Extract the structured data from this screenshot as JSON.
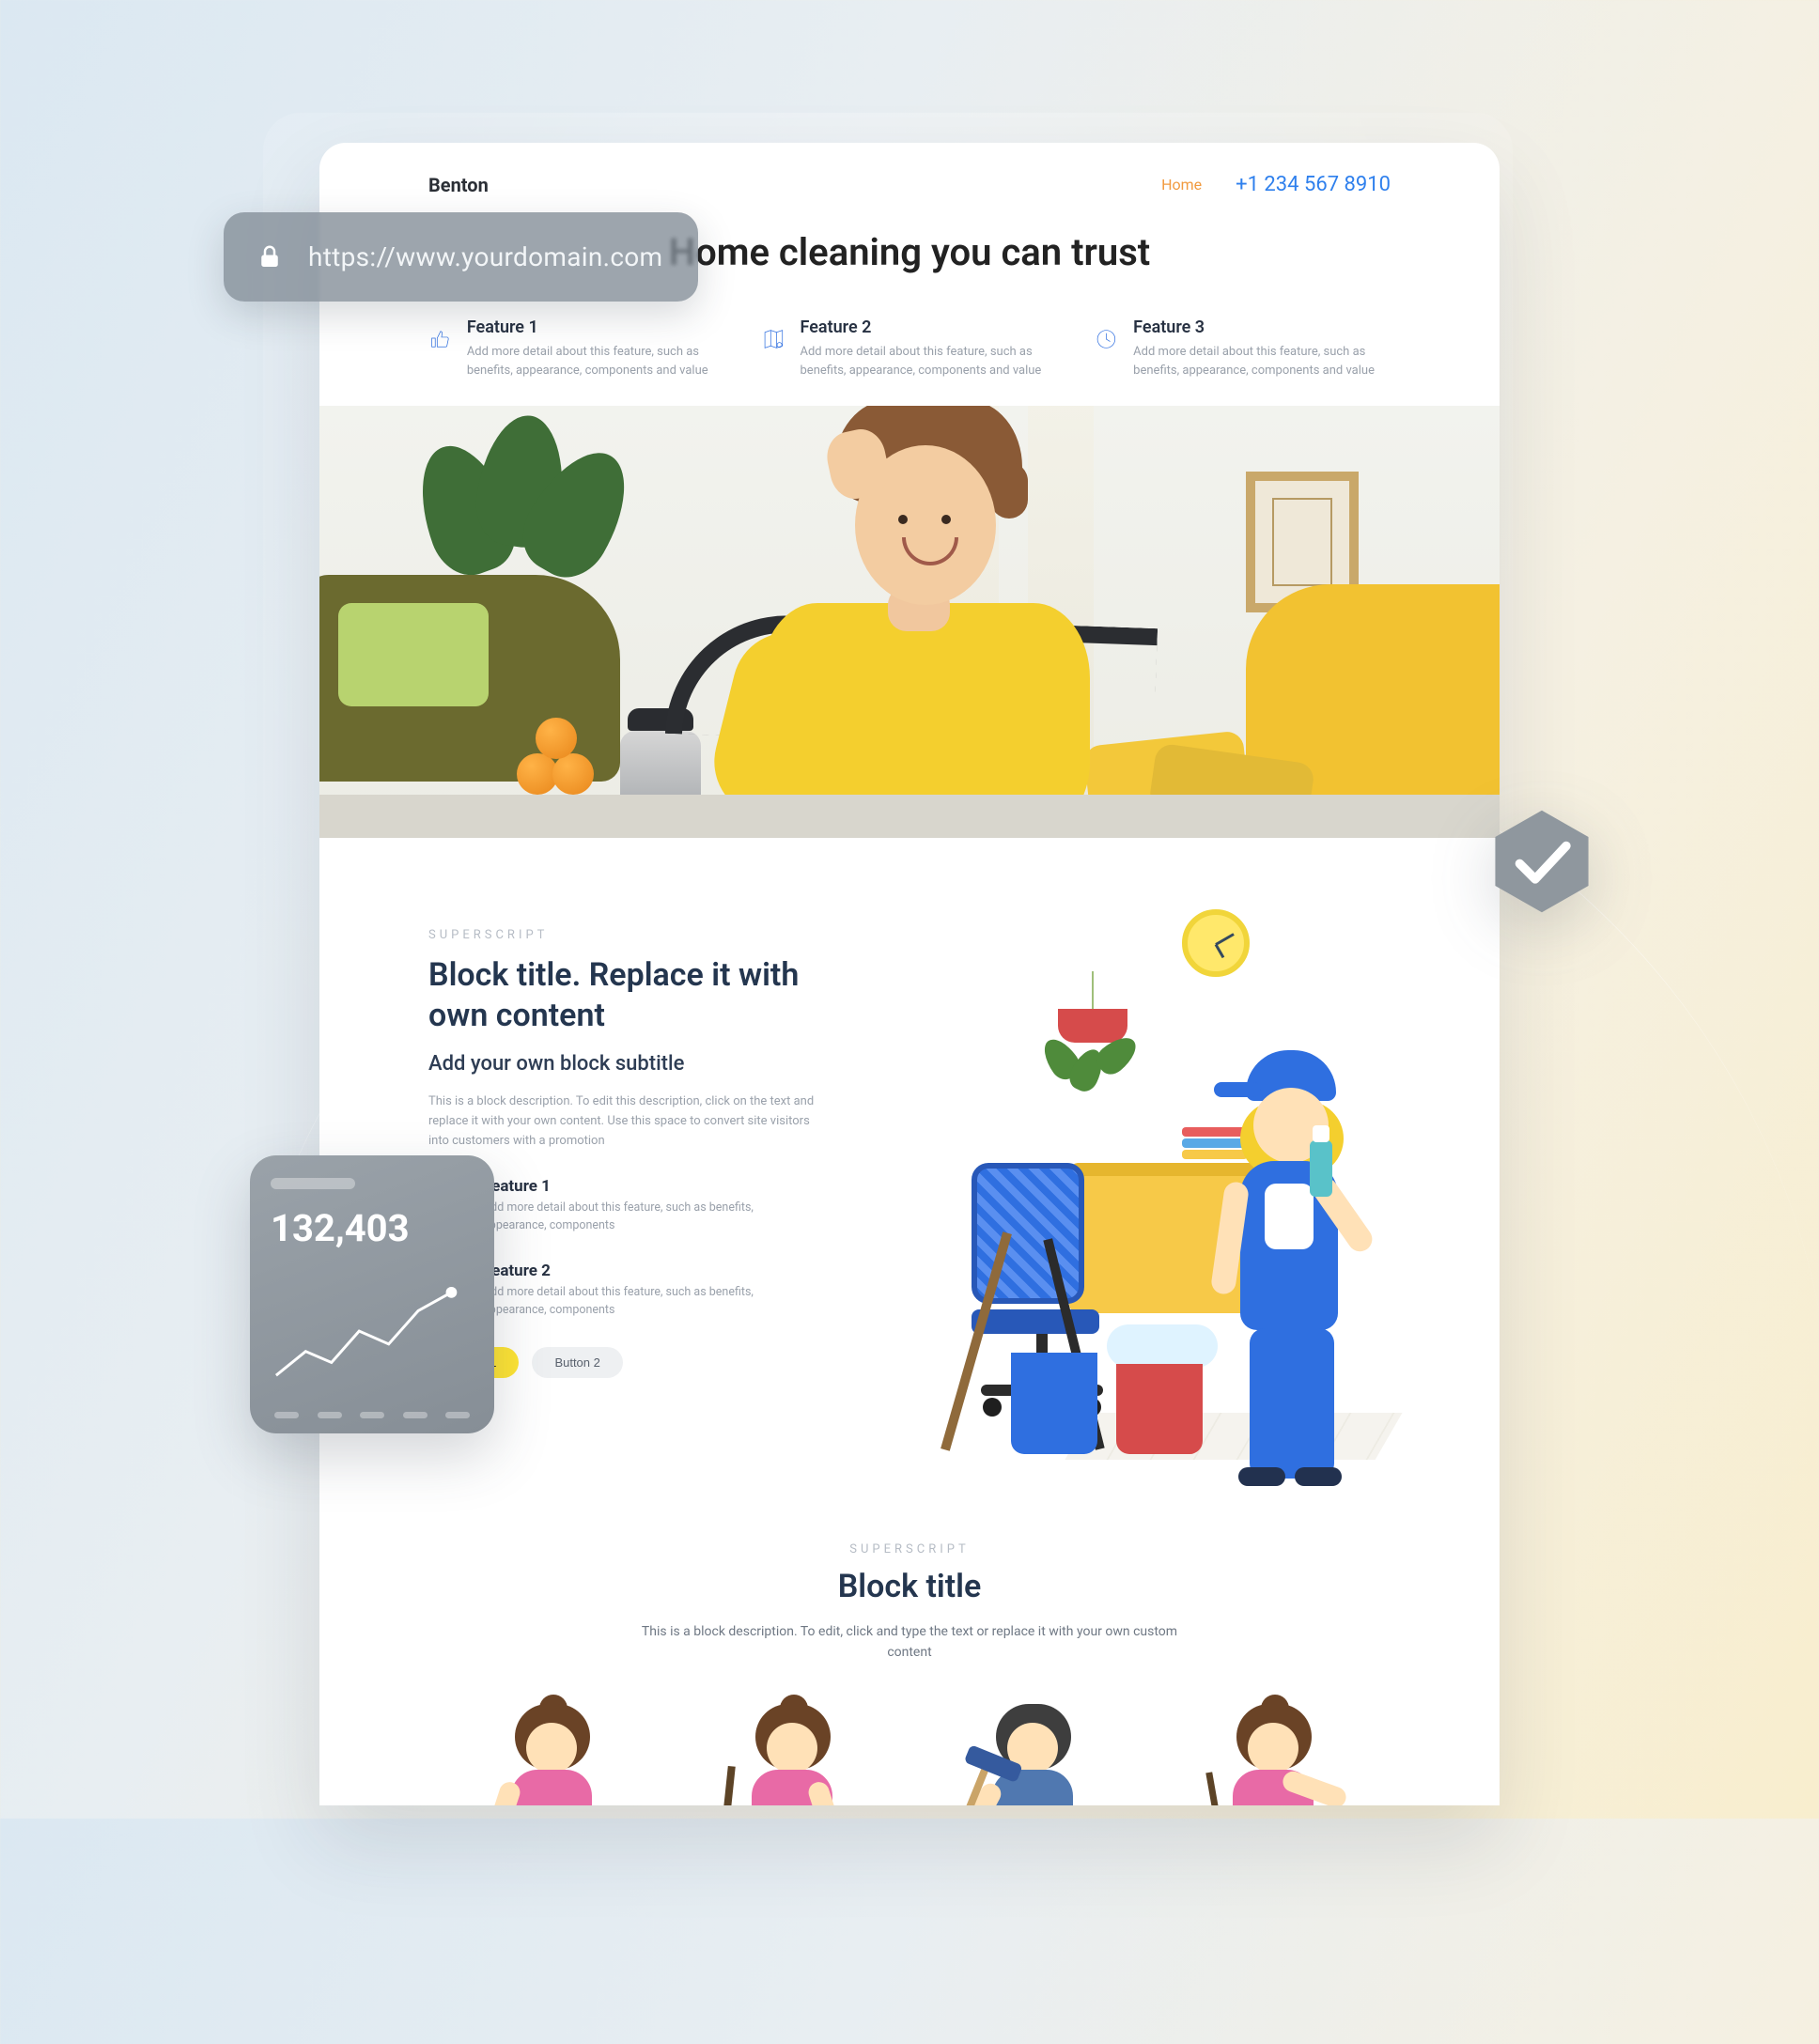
{
  "url_bar": {
    "url": "https://www.yourdomain.com"
  },
  "stats_card": {
    "value": "132,403"
  },
  "site": {
    "brand": "Benton",
    "nav": {
      "home": "Home",
      "phone": "+1 234 567 8910"
    },
    "hero_title": "Home cleaning you can trust",
    "feature_desc": "Add more detail about this feature, such as benefits, appearance, components and value",
    "features": [
      {
        "title": "Feature 1"
      },
      {
        "title": "Feature 2"
      },
      {
        "title": "Feature 3"
      }
    ],
    "block1": {
      "super": "SUPERSCRIPT",
      "title": "Block title. Replace it with own content",
      "subtitle": "Add your own block subtitle",
      "desc": "This is a block description. To edit this description, click on the text and replace it with your own content. Use this space to convert site visitors into customers with a promotion",
      "sub_desc": "Add more detail about this feature, such as benefits, appearance, components",
      "subfeatures": [
        {
          "title": "Feature 1"
        },
        {
          "title": "Feature 2"
        }
      ],
      "buttons": {
        "primary": "Button 1",
        "secondary": "Button 2"
      }
    },
    "block2": {
      "super": "SUPERSCRIPT",
      "title": "Block title",
      "desc": "This is a block description. To edit, click and type the text or replace it with your own custom content"
    }
  }
}
